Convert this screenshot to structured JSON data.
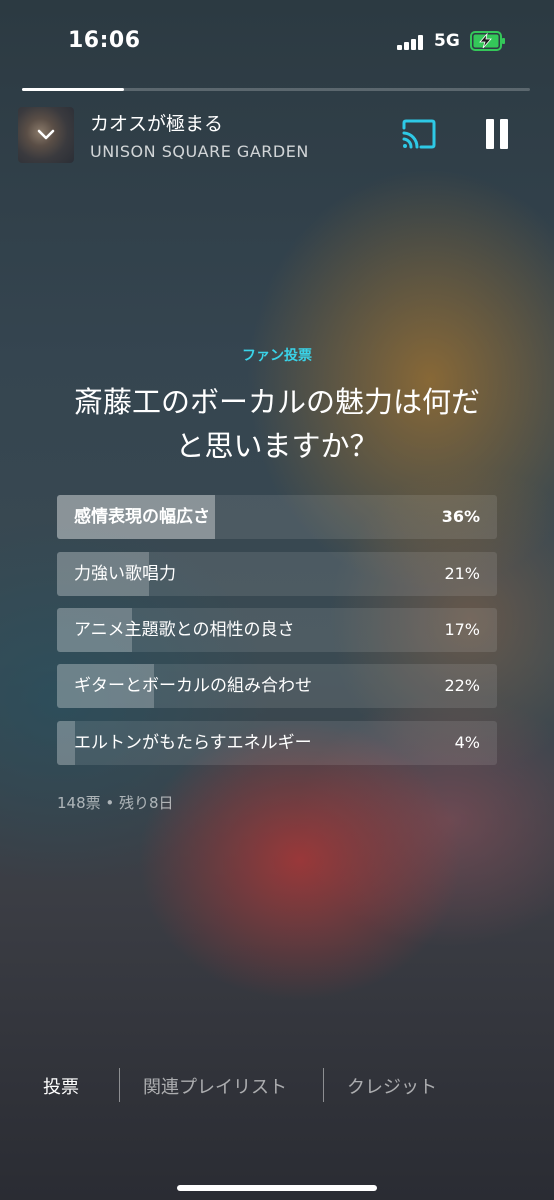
{
  "status_bar": {
    "time": "16:06",
    "network": "5G",
    "battery_icon": "battery-charging-icon",
    "signal_icon": "signal-bars-icon"
  },
  "player": {
    "progress": 0.2,
    "song_title": "カオスが極まる",
    "artist": "UNISON SQUARE GARDEN",
    "collapse_icon": "chevron-down-icon",
    "cast_icon": "cast-icon",
    "pause_icon": "pause-icon",
    "accent_color": "#2ec9e6"
  },
  "poll": {
    "kicker": "ファン投票",
    "question_line1": "斎藤工のボーカルの魅力は何だ",
    "question_line2": "と思いますか？",
    "options": [
      {
        "label": "感情表現の幅広さ",
        "percent_text": "36%",
        "percent": 36
      },
      {
        "label": "力強い歌唱力",
        "percent_text": "21%",
        "percent": 21
      },
      {
        "label": "アニメ主題歌との相性の良さ",
        "percent_text": "17%",
        "percent": 17
      },
      {
        "label": "ギターとボーカルの組み合わせ",
        "percent_text": "22%",
        "percent": 22
      },
      {
        "label": "エルトンがもたらすエネルギー",
        "percent_text": "4%",
        "percent": 4
      }
    ],
    "meta": "148票 • 残り8日"
  },
  "tabs": [
    {
      "label": "投票"
    },
    {
      "label": "関連プレイリスト"
    },
    {
      "label": "クレジット"
    }
  ]
}
